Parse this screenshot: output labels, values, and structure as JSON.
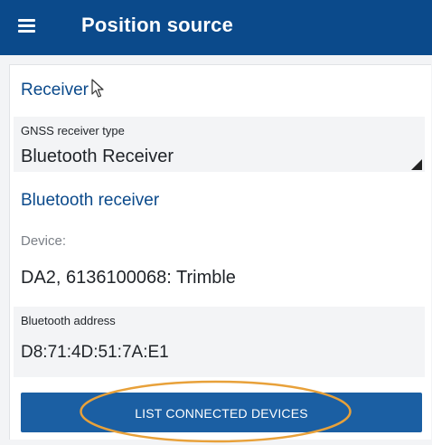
{
  "app_bar": {
    "title": "Position source",
    "menu_icon": "hamburger-menu-icon"
  },
  "receiver_section": {
    "heading": "Receiver",
    "gnss_field": {
      "label": "GNSS receiver type",
      "value": "Bluetooth Receiver"
    }
  },
  "bluetooth_section": {
    "heading": "Bluetooth receiver",
    "device_label": "Device:",
    "device_value": "DA2, 6136100068: Trimble",
    "address_field": {
      "label": "Bluetooth address",
      "value": "D8:71:4D:51:7A:E1"
    },
    "list_button_label": "LIST CONNECTED DEVICES"
  },
  "colors": {
    "app_bar": "#0b4a8b",
    "accent_text": "#0b4a8b",
    "button": "#1b5fa3",
    "highlight_ring": "#e8a13a"
  }
}
